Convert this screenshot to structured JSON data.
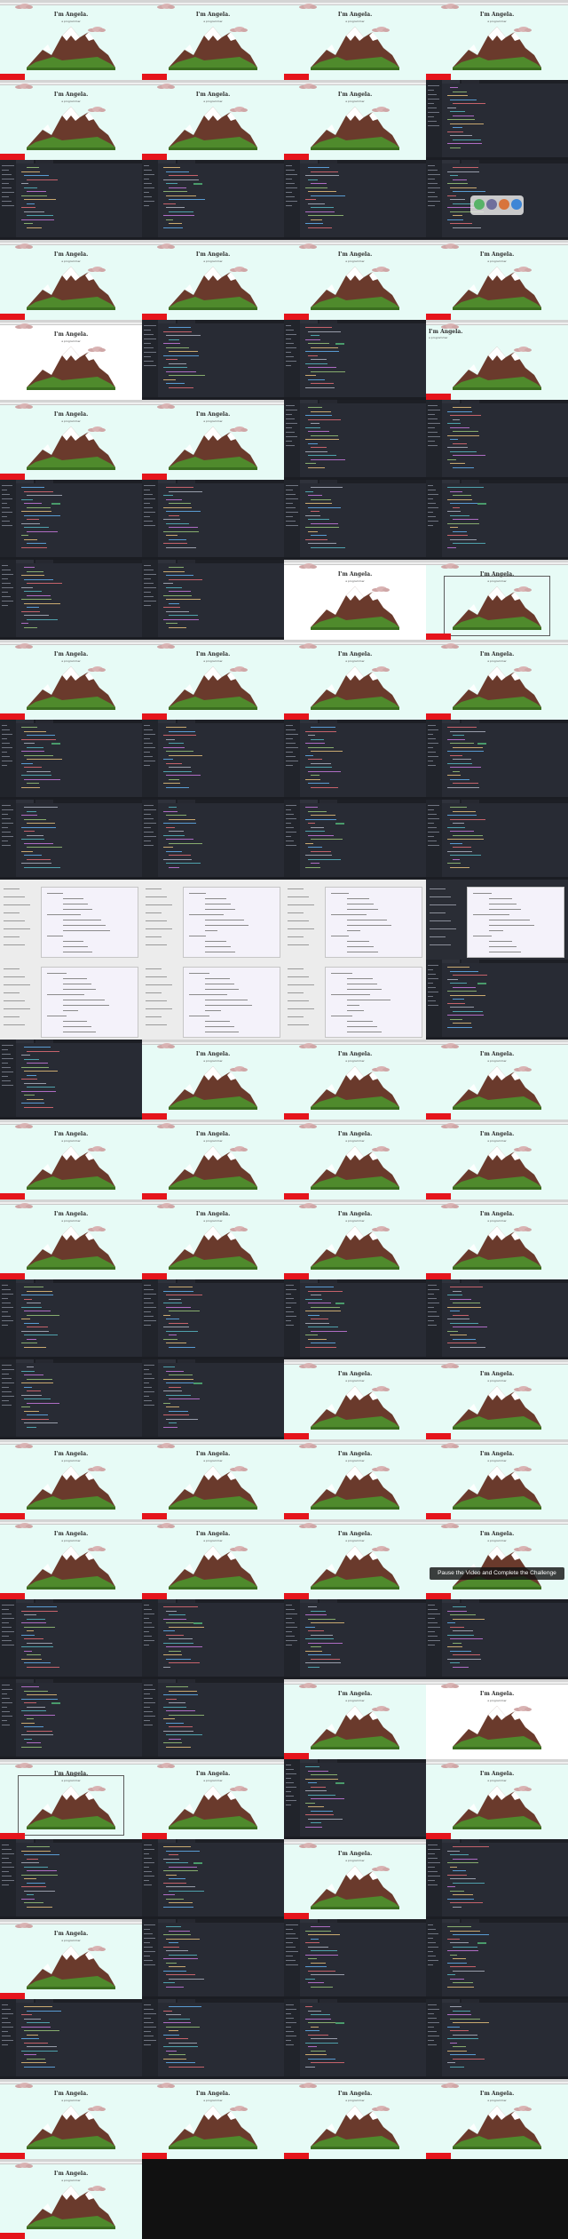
{
  "site": {
    "title": "I'm Angela.",
    "subtitle": "a programmer"
  },
  "overlay": {
    "challenge_text": "Pause the Video and Complete the Challenge"
  },
  "colors": {
    "sky": "#e7fbf6",
    "redbar": "#e5141b",
    "editor_bg": "#282b34",
    "mountain_dark": "#5b2f24",
    "mountain_snow": "#ffffff",
    "grass": "#4f8a2c"
  },
  "tiles": [
    "web",
    "web",
    "web",
    "web",
    "web",
    "web",
    "web",
    "editor",
    "editor",
    "editor",
    "editor",
    "editor",
    "web",
    "web",
    "web",
    "web",
    "web-white",
    "editor",
    "editor",
    "web-left",
    "web-left-devtools",
    "web",
    "editor",
    "editor",
    "editor",
    "editor",
    "editor",
    "editor",
    "editor",
    "editor",
    "web-white",
    "web-boxed",
    "devtools",
    "devtools",
    "devtools",
    "web",
    "editor",
    "editor",
    "editor",
    "editor",
    "editor",
    "editor",
    "editor",
    "editor",
    "doc",
    "doc",
    "doc",
    "doc-dark",
    "doc",
    "doc",
    "doc",
    "editor",
    "editor",
    "web",
    "web",
    "web",
    "web",
    "web",
    "web",
    "web",
    "web",
    "web",
    "web",
    "web",
    "editor",
    "editor",
    "editor",
    "editor",
    "editor",
    "editor",
    "web",
    "web",
    "web",
    "web",
    "web",
    "web",
    "web",
    "web",
    "web",
    "web",
    "editor",
    "editor",
    "editor",
    "editor",
    "editor",
    "editor",
    "web",
    "web-white",
    "web-boxed",
    "web",
    "editor",
    "web",
    "editor",
    "editor",
    "web",
    "editor",
    "web",
    "editor",
    "editor",
    "editor",
    "editor",
    "editor",
    "editor",
    "editor",
    "web",
    "web",
    "web",
    "web",
    "web",
    "black",
    "black",
    "black"
  ]
}
